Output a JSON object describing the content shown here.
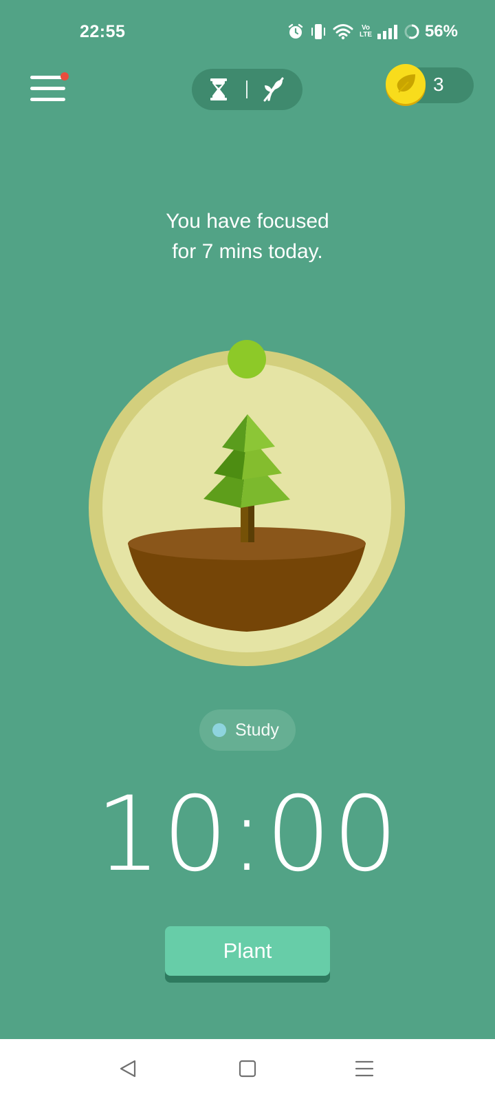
{
  "status_bar": {
    "time": "22:55",
    "battery_percent": "56%",
    "icons": [
      "alarm-icon",
      "vibrate-icon",
      "wifi-icon",
      "volte-icon",
      "signal-icon",
      "battery-ring-icon"
    ],
    "volte_line1": "Vo",
    "volte_line2": "LTE"
  },
  "header": {
    "menu_icon": "menu-icon",
    "menu_has_notification": true,
    "mode_icons": [
      "hourglass-icon",
      "sapling-icon"
    ],
    "coin_icon": "coin-icon",
    "coin_count": "3"
  },
  "main": {
    "focus_message_line1": "You have focused",
    "focus_message_line2": "for 7 mins today.",
    "tag": {
      "label": "Study",
      "color": "#8ed4de"
    },
    "timer": "10:00",
    "plant_button_label": "Plant"
  },
  "nav_bar": {
    "buttons": [
      "back-icon",
      "home-icon",
      "recents-icon"
    ]
  },
  "colors": {
    "background": "#52a386",
    "accent_button": "#67cda8",
    "coin": "#f2d31a",
    "progress_knob": "#8dc928",
    "ring_outer": "#d3cf7d",
    "ring_inner": "#e5e4a5",
    "soil": "#754507"
  }
}
